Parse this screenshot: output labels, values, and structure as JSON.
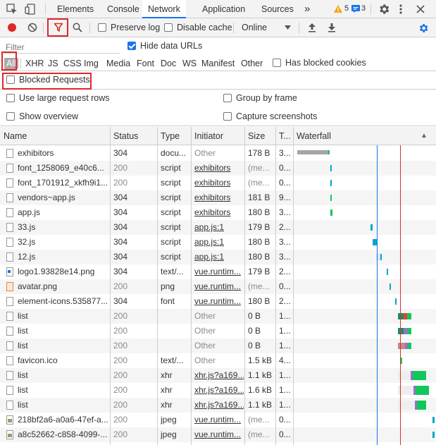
{
  "tabs": {
    "items": [
      "Elements",
      "Console",
      "Network",
      "Application",
      "Sources"
    ],
    "active": "Network",
    "more_glyph": "»",
    "warnings_count": "5",
    "messages_count": "3"
  },
  "toolbar": {
    "preserve_log_label": "Preserve log",
    "disable_cache_label": "Disable cache",
    "throttle_value": "Online"
  },
  "filter": {
    "placeholder": "Filter",
    "hide_data_urls_label": "Hide data URLs",
    "types": [
      "All",
      "XHR",
      "JS",
      "CSS",
      "Img",
      "Media",
      "Font",
      "Doc",
      "WS",
      "Manifest",
      "Other"
    ],
    "has_blocked_cookies_label": "Has blocked cookies",
    "blocked_requests_label": "Blocked Requests"
  },
  "settings": {
    "large_rows_label": "Use large request rows",
    "group_by_frame_label": "Group by frame",
    "show_overview_label": "Show overview",
    "capture_screenshots_label": "Capture screenshots"
  },
  "table": {
    "headers": {
      "name": "Name",
      "status": "Status",
      "type": "Type",
      "initiator": "Initiator",
      "size": "Size",
      "time": "T...",
      "waterfall": "Waterfall",
      "sort_glyph": "▲"
    },
    "rows": [
      {
        "name": "exhibitors",
        "status": "304",
        "type": "docu...",
        "initiator": "Other",
        "size": "178 B",
        "time": "3..."
      },
      {
        "name": "font_1258069_e40c6...",
        "status": "200",
        "type": "script",
        "initiator": "exhibitors",
        "size": "(me...",
        "time": "0..."
      },
      {
        "name": "font_1701912_xkfh9i1...",
        "status": "200",
        "type": "script",
        "initiator": "exhibitors",
        "size": "(me...",
        "time": "0..."
      },
      {
        "name": "vendors~app.js",
        "status": "304",
        "type": "script",
        "initiator": "exhibitors",
        "size": "181 B",
        "time": "9..."
      },
      {
        "name": "app.js",
        "status": "304",
        "type": "script",
        "initiator": "exhibitors",
        "size": "180 B",
        "time": "3..."
      },
      {
        "name": "33.js",
        "status": "304",
        "type": "script",
        "initiator": "app.js:1",
        "size": "179 B",
        "time": "2..."
      },
      {
        "name": "32.js",
        "status": "304",
        "type": "script",
        "initiator": "app.js:1",
        "size": "180 B",
        "time": "3..."
      },
      {
        "name": "12.js",
        "status": "304",
        "type": "script",
        "initiator": "app.js:1",
        "size": "180 B",
        "time": "3..."
      },
      {
        "name": "logo1.93828e14.png",
        "status": "304",
        "type": "text/...",
        "initiator": "vue.runtim...",
        "size": "179 B",
        "time": "2..."
      },
      {
        "name": "avatar.png",
        "status": "200",
        "type": "png",
        "initiator": "vue.runtim...",
        "size": "(me...",
        "time": "0..."
      },
      {
        "name": "element-icons.535877...",
        "status": "304",
        "type": "font",
        "initiator": "vue.runtim...",
        "size": "180 B",
        "time": "2..."
      },
      {
        "name": "list",
        "status": "200",
        "type": "",
        "initiator": "Other",
        "size": "0 B",
        "time": "1..."
      },
      {
        "name": "list",
        "status": "200",
        "type": "",
        "initiator": "Other",
        "size": "0 B",
        "time": "1..."
      },
      {
        "name": "list",
        "status": "200",
        "type": "",
        "initiator": "Other",
        "size": "0 B",
        "time": "1..."
      },
      {
        "name": "favicon.ico",
        "status": "200",
        "type": "text/...",
        "initiator": "Other",
        "size": "1.5 kB",
        "time": "4..."
      },
      {
        "name": "list",
        "status": "200",
        "type": "xhr",
        "initiator": "xhr.js?a169...",
        "size": "1.1 kB",
        "time": "1..."
      },
      {
        "name": "list",
        "status": "200",
        "type": "xhr",
        "initiator": "xhr.js?a169...",
        "size": "1.6 kB",
        "time": "1..."
      },
      {
        "name": "list",
        "status": "200",
        "type": "xhr",
        "initiator": "xhr.js?a169...",
        "size": "1.1 kB",
        "time": "1..."
      },
      {
        "name": "218bf2a6-a0a6-47ef-a...",
        "status": "200",
        "type": "jpeg",
        "initiator": "vue.runtim...",
        "size": "(me...",
        "time": "0..."
      },
      {
        "name": "a8c52662-c858-4099-...",
        "status": "200",
        "type": "jpeg",
        "initiator": "vue.runtim...",
        "size": "(me...",
        "time": "0..."
      }
    ]
  },
  "colors": {
    "accent": "#1a73e8",
    "record_red": "#e0262b",
    "annotation_red": "#e0262b",
    "waterfall_green": "#0fc85c",
    "waterfall_teal": "#00a7c8",
    "waterfall_gray": "#a5a5a5",
    "dom_content_loaded_line": "#1a73e8",
    "load_line": "#d93025"
  }
}
